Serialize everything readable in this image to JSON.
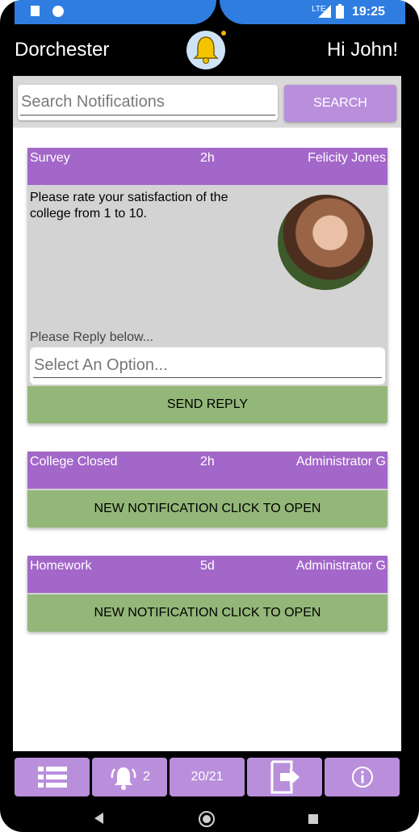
{
  "status_bar": {
    "time": "19:25",
    "network_label": "LTE"
  },
  "header": {
    "school": "Dorchester",
    "greeting": "Hi John!",
    "logo_icon": "bell-icon"
  },
  "search": {
    "placeholder": "Search Notifications",
    "button_label": "SEARCH"
  },
  "notifications": [
    {
      "title": "Survey",
      "age": "2h",
      "sender": "Felicity Jones",
      "message": "Please rate your satisfaction of the college from 1 to 10.",
      "reply_prompt": "Please Reply below...",
      "select_placeholder": "Select An Option...",
      "button_label": "SEND REPLY"
    },
    {
      "title": "College Closed",
      "age": "2h",
      "sender": "Administrator G",
      "button_label": "NEW NOTIFICATION CLICK TO OPEN"
    },
    {
      "title": "Homework",
      "age": "5d",
      "sender": "Administrator G",
      "button_label": "NEW NOTIFICATION CLICK TO OPEN"
    }
  ],
  "bottom_nav": {
    "list_icon": "list-icon",
    "alerts_icon": "alarm-icon",
    "alerts_count": "2",
    "term_label": "20/21",
    "logout_icon": "logout-icon",
    "info_icon": "info-icon"
  },
  "colors": {
    "accent_purple": "#a367c9",
    "button_purple": "#b98fdc",
    "green": "#93b778",
    "status_blue": "#2f7de1"
  }
}
